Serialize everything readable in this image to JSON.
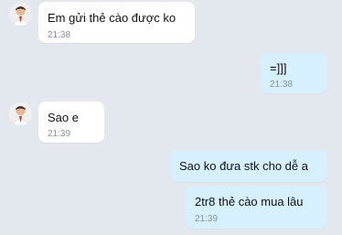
{
  "conversation": {
    "messages": [
      {
        "direction": "incoming",
        "text": "Em gửi thẻ cào được ko",
        "time": "21:38"
      },
      {
        "direction": "outgoing",
        "text": "=]]]",
        "time": "21:38"
      },
      {
        "direction": "incoming",
        "text": "Sao e",
        "time": "21:39"
      },
      {
        "direction": "outgoing",
        "text": "Sao ko đưa stk cho dễ a",
        "time": ""
      },
      {
        "direction": "outgoing",
        "text": "2tr8 thẻ cào mua lâu",
        "time": "21:39"
      }
    ]
  },
  "colors": {
    "background": "#e3e8ef",
    "incoming_bubble": "#ffffff",
    "outgoing_bubble": "#d6f0ff",
    "timestamp": "#8a8f96"
  },
  "icons": {
    "contact_avatar": "contact-avatar-icon"
  }
}
